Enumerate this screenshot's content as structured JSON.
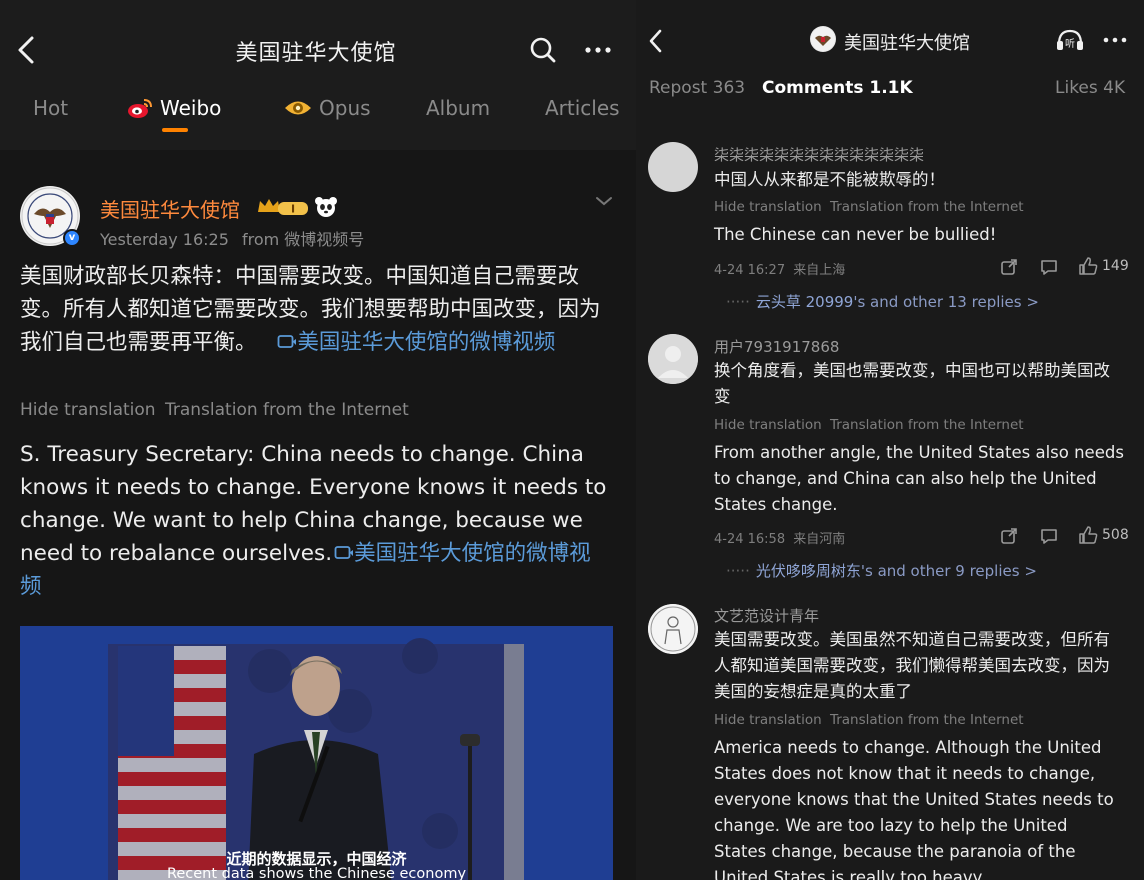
{
  "left": {
    "header": {
      "title": "美国驻华大使馆"
    },
    "tabs": [
      {
        "label": "Hot"
      },
      {
        "label": "Weibo"
      },
      {
        "label": "Opus"
      },
      {
        "label": "Album"
      },
      {
        "label": "Articles"
      }
    ],
    "post": {
      "author": "美国驻华大使馆",
      "crown_badge": "I",
      "time": "Yesterday 16:25",
      "source": "from 微博视频号",
      "text_cn": "美国财政部长贝森特：中国需要改变。中国知道自己需要改变。所有人都知道它需要改变。我们想要帮助中国改变，因为我们自己也需要再平衡。",
      "link_cn": "美国驻华大使馆的微博视频",
      "hide_translation": "Hide translation",
      "translation_source": "Translation from the Internet",
      "text_en": "S. Treasury Secretary: China needs to change. China knows it needs to change. Everyone knows it needs to change. We want to help China change, because we need to rebalance ourselves.",
      "link_en": "美国驻华大使馆的微博视频",
      "video": {
        "subtitle_cn": "近期的数据显示，中国经济",
        "subtitle_en": "Recent data shows the Chinese economy"
      }
    }
  },
  "right": {
    "header": {
      "title": "美国驻华大使馆",
      "listen_label": "听"
    },
    "tabs": [
      {
        "label": "Repost 363"
      },
      {
        "label": "Comments 1.1K"
      },
      {
        "label": "Likes 4K"
      }
    ],
    "comments": [
      {
        "user": "柒柒柒柒柒柒柒柒柒柒柒柒柒柒",
        "text": "中国人从来都是不能被欺辱的！",
        "hide_translation": "Hide translation",
        "translation_source": "Translation from the Internet",
        "translation": "The Chinese can never be bullied!",
        "time": "4-24 16:27",
        "location": "来自上海",
        "likes": "149",
        "replies_name": "云头草 20999",
        "replies_rest": "'s and other 13 replies >"
      },
      {
        "user": "用户7931917868",
        "text": "换个角度看，美国也需要改变，中国也可以帮助美国改变",
        "hide_translation": "Hide translation",
        "translation_source": "Translation from the Internet",
        "translation": "From another angle, the United States also needs to change, and China can also help the United States change.",
        "time": "4-24 16:58",
        "location": "来自河南",
        "likes": "508",
        "replies_name": "光伏哆哆周树东",
        "replies_rest": "'s and other 9 replies >"
      },
      {
        "user": "文艺范设计青年",
        "text": "美国需要改变。美国虽然不知道自己需要改变，但所有人都知道美国需要改变，我们懒得帮美国去改变，因为美国的妄想症是真的太重了",
        "hide_translation": "Hide translation",
        "translation_source": "Translation from the Internet",
        "translation": "America needs to change. Although the United States does not know that it needs to change, everyone knows that the United States needs to change. We are too lazy to help the United States change, because the paranoia of the United States is really too heavy"
      }
    ]
  },
  "colors": {
    "accent_orange": "#ff8200",
    "author_orange": "#ff8a3d",
    "link_blue": "#5b9bd9",
    "verified_blue": "#2e86ff"
  },
  "icons": [
    "back-icon",
    "search-icon",
    "more-icon",
    "weibo-icon",
    "opus-icon",
    "crown-badge-icon",
    "panda-icon",
    "chevron-down-icon",
    "video-link-icon",
    "verified-icon",
    "listen-icon",
    "share-icon",
    "reply-icon",
    "like-icon"
  ]
}
